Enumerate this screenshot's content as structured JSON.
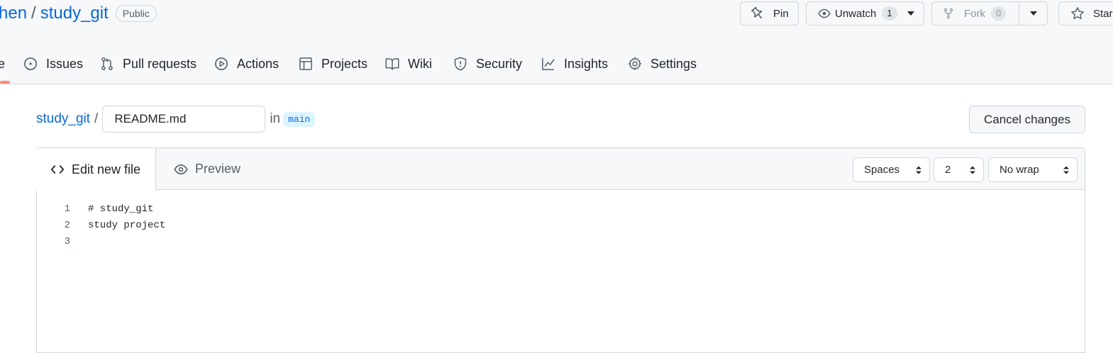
{
  "repo": {
    "owner": "hen",
    "separator": "/",
    "name": "study_git",
    "visibility": "Public"
  },
  "actions": {
    "pin": "Pin",
    "unwatch": "Unwatch",
    "unwatch_count": "1",
    "fork": "Fork",
    "fork_count": "0",
    "star": "Star"
  },
  "tabs": [
    {
      "label": "e",
      "icon": "code-icon"
    },
    {
      "label": "Issues",
      "icon": "issue-icon"
    },
    {
      "label": "Pull requests",
      "icon": "pull-request-icon"
    },
    {
      "label": "Actions",
      "icon": "play-icon"
    },
    {
      "label": "Projects",
      "icon": "table-icon"
    },
    {
      "label": "Wiki",
      "icon": "book-icon"
    },
    {
      "label": "Security",
      "icon": "shield-icon"
    },
    {
      "label": "Insights",
      "icon": "graph-icon"
    },
    {
      "label": "Settings",
      "icon": "gear-icon"
    }
  ],
  "breadcrumb": {
    "repo": "study_git",
    "separator": "/",
    "filename": "README.md",
    "in": "in",
    "branch": "main"
  },
  "cancel_label": "Cancel changes",
  "editor": {
    "tab_edit": "Edit new file",
    "tab_preview": "Preview",
    "indent_mode": "Spaces",
    "indent_size": "2",
    "wrap_mode": "No wrap",
    "lines": [
      {
        "number": "1",
        "text": "# study_git"
      },
      {
        "number": "2",
        "text": "study project"
      },
      {
        "number": "3",
        "text": ""
      }
    ]
  },
  "colors": {
    "link": "#0969da",
    "tab_underline": "#fd8c73",
    "header_bg": "#f6f8fa",
    "border": "#d0d7de"
  }
}
